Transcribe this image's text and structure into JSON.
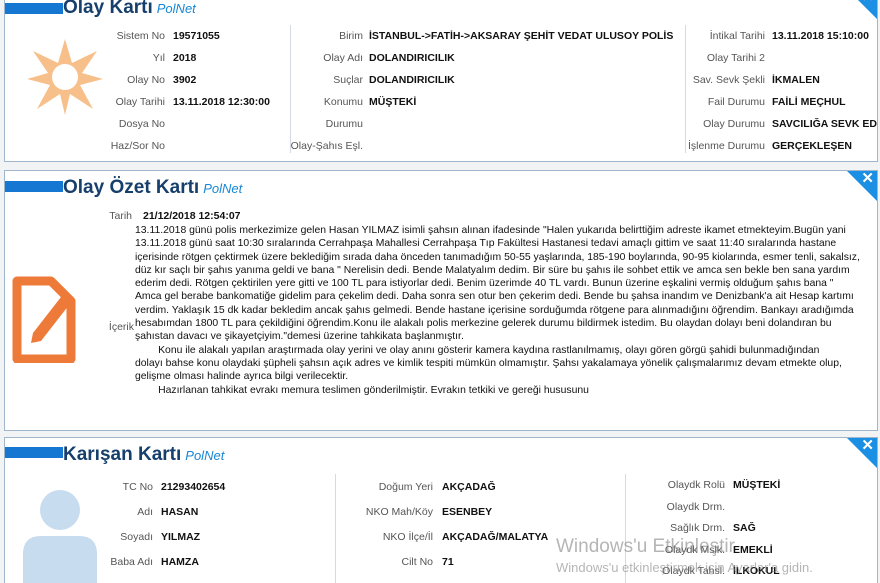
{
  "olay_karti": {
    "title": "Olay Kartı",
    "brand": "PolNet",
    "close": "✕",
    "left": [
      {
        "label": "Sistem No",
        "value": "19571055"
      },
      {
        "label": "Yıl",
        "value": "2018"
      },
      {
        "label": "Olay No",
        "value": "3902"
      },
      {
        "label": "Olay Tarihi",
        "value": "13.11.2018 12:30:00"
      },
      {
        "label": "Dosya No",
        "value": ""
      },
      {
        "label": "Haz/Sor No",
        "value": ""
      }
    ],
    "middle": [
      {
        "label": "Birim",
        "value": "İSTANBUL->FATİH->AKSARAY ŞEHİT VEDAT ULUSOY POLİS MERKEZİ AMİRLİĞİ"
      },
      {
        "label": "Olay Adı",
        "value": "DOLANDIRICILIK"
      },
      {
        "label": "Suçlar",
        "value": "DOLANDIRICILIK"
      },
      {
        "label": "Konumu",
        "value": "MÜŞTEKİ"
      },
      {
        "label": "Durumu",
        "value": ""
      },
      {
        "label": "Olay-Şahıs Eşl.",
        "value": ""
      }
    ],
    "right": [
      {
        "label": "İntikal Tarihi",
        "value": "13.11.2018 15:10:00"
      },
      {
        "label": "Olay Tarihi 2",
        "value": ""
      },
      {
        "label": "Sav. Sevk Şekli",
        "value": "İKMALEN"
      },
      {
        "label": "Fail Durumu",
        "value": "FAİLİ MEÇHUL"
      },
      {
        "label": "Olay Durumu",
        "value": "SAVCILIĞA SEVK EDİLDİ"
      },
      {
        "label": "İşlenme Durumu",
        "value": "GERÇEKLEŞEN"
      }
    ]
  },
  "ozet_karti": {
    "title": "Olay Özet Kartı",
    "brand": "PolNet",
    "close": "✕",
    "tarih_label": "Tarih",
    "tarih_value": "21/12/2018 12:54:07",
    "icerik_label": "İçerik",
    "icerik": "13.11.2018 günü polis merkezimize gelen Hasan YILMAZ isimli şahsın alınan ifadesinde \"Halen yukarıda belirttiğim adreste ikamet etmekteyim.Bugün yani\n13.11.2018 günü saat 10:30 sıralarında Cerrahpaşa Mahallesi Cerrahpaşa Tıp Fakültesi Hastanesi tedavi amaçlı gittim ve saat 11:40 sıralarında hastane\niçerisinde rötgen çektirmek üzere beklediğim sırada daha önceden tanımadığım 50-55 yaşlarında, 185-190 boylarında, 90-95 kiolarında, esmer tenli, sakalsız,\ndüz kır saçlı bir şahıs yanıma geldi ve bana \" Nerelisin dedi. Bende Malatyalım dedim. Bir süre bu şahıs ile sohbet ettik ve amca sen bekle ben sana yardım\nederim dedi. Rötgen çektirilen yere gitti ve 100 TL para istiyorlar dedi. Benim üzerimde 40 TL vardı. Bunun üzerine eşkalini vermiş olduğum şahıs bana \"\nAmca gel berabe bankomatiğe gidelim para çekelim dedi. Daha sonra sen otur ben çekerim dedi. Bende bu şahsa inandım ve Denizbank'a ait Hesap kartımı\nverdim. Yaklaşık 15 dk kadar bekledim ancak şahıs gelmedi. Bende hastane içerisine sorduğumda rötgene para alınmadığını öğrendim. Bankayı aradığımda\nhesabımdan 1800 TL para çekildiğini öğrendim.Konu ile alakalı polis merkezine gelerek durumu bildirmek istedim. Bu olaydan dolayı beni dolandıran bu\nşahıstan davacı ve şikayetçiyim.\"demesi üzerine tahkikata başlanmıştır.\n        Konu ile alakalı yapılan araştırmada olay yerini ve olay anını gösterir kamera kaydına rastlanılmamış, olayı gören görgü şahidi bulunmadığından\ndolayı bahse konu olaydaki şüpheli şahsın açık adres ve kimlik tespiti mümkün olmamıştır. Şahsı yakalamaya yönelik çalışmalarımız devam etmekte olup,\ngelişme olması halinde ayrıca bilgi verilecektir.\n        Hazırlanan tahkikat evrakı memura teslimen gönderilmiştir. Evrakın tetkiki ve gereği hususunu"
  },
  "karisan_karti": {
    "title": "Karışan Kartı",
    "brand": "PolNet",
    "close": "✕",
    "left": [
      {
        "label": "TC No",
        "value": "21293402654"
      },
      {
        "label": "Adı",
        "value": "HASAN"
      },
      {
        "label": "Soyadı",
        "value": "YILMAZ"
      },
      {
        "label": "Baba Adı",
        "value": "HAMZA"
      }
    ],
    "middle": [
      {
        "label": "Doğum Yeri",
        "value": "AKÇADAĞ"
      },
      {
        "label": "NKO Mah/Köy",
        "value": "ESENBEY"
      },
      {
        "label": "NKO İlçe/İl",
        "value": "AKÇADAĞ/MALATYA"
      },
      {
        "label": "Cilt No",
        "value": "71"
      }
    ],
    "right": [
      {
        "label": "Olaydk Rolü",
        "value": "MÜŞTEKİ"
      },
      {
        "label": "Olaydk Drm.",
        "value": ""
      },
      {
        "label": "Sağlık Drm.",
        "value": "SAĞ"
      },
      {
        "label": "Olaydk Mslk.",
        "value": "EMEKLİ"
      },
      {
        "label": "Olaydk Tahsl.",
        "value": "İLKOKUL"
      }
    ]
  },
  "watermark": {
    "line1": "Windows'u Etkinleştir",
    "line2": "Windows'u etkinleştirmek için Ayarlar'a gidin."
  },
  "colors": {
    "accent": "#1677d2",
    "title": "#163f6c",
    "icon_orange": "#f7c08a",
    "icon_orange_dark": "#ee7a3a",
    "icon_blue": "#c7dcef"
  }
}
